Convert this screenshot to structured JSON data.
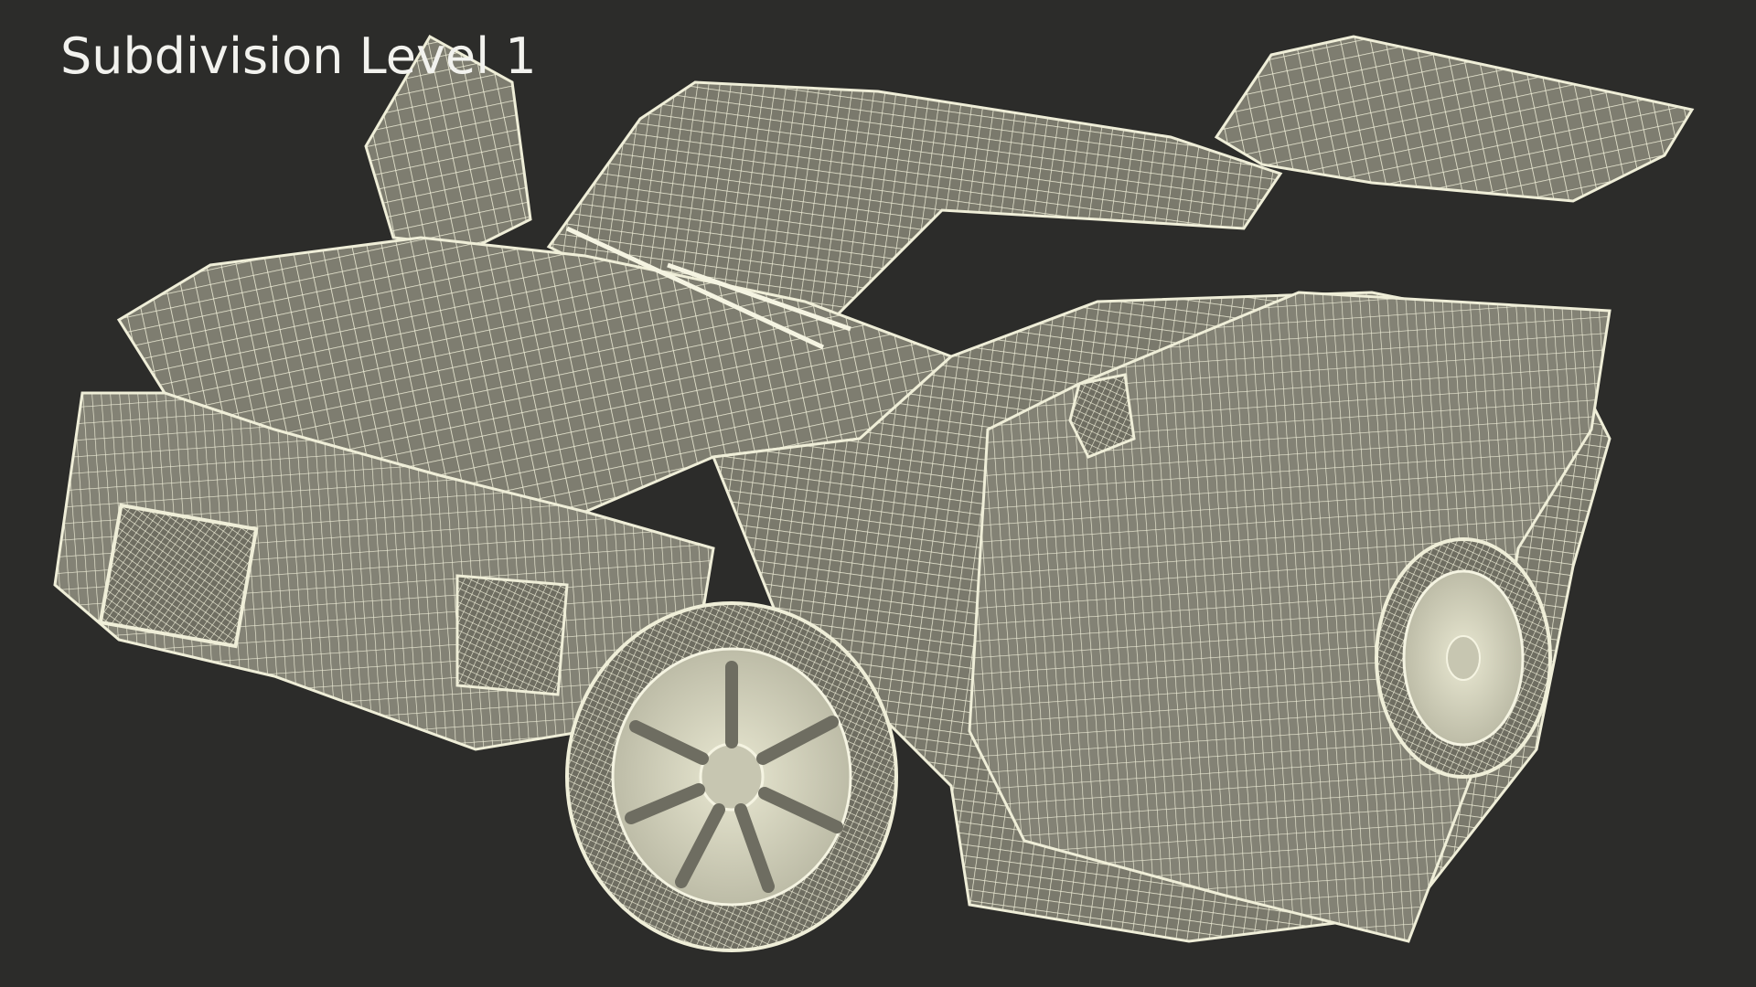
{
  "caption": "Subdivision Level 1",
  "colors": {
    "background": "#2c2c2a",
    "mesh_fill": "#7e7d70",
    "mesh_wire": "#efeed8",
    "caption_text": "#f2f2ee"
  }
}
